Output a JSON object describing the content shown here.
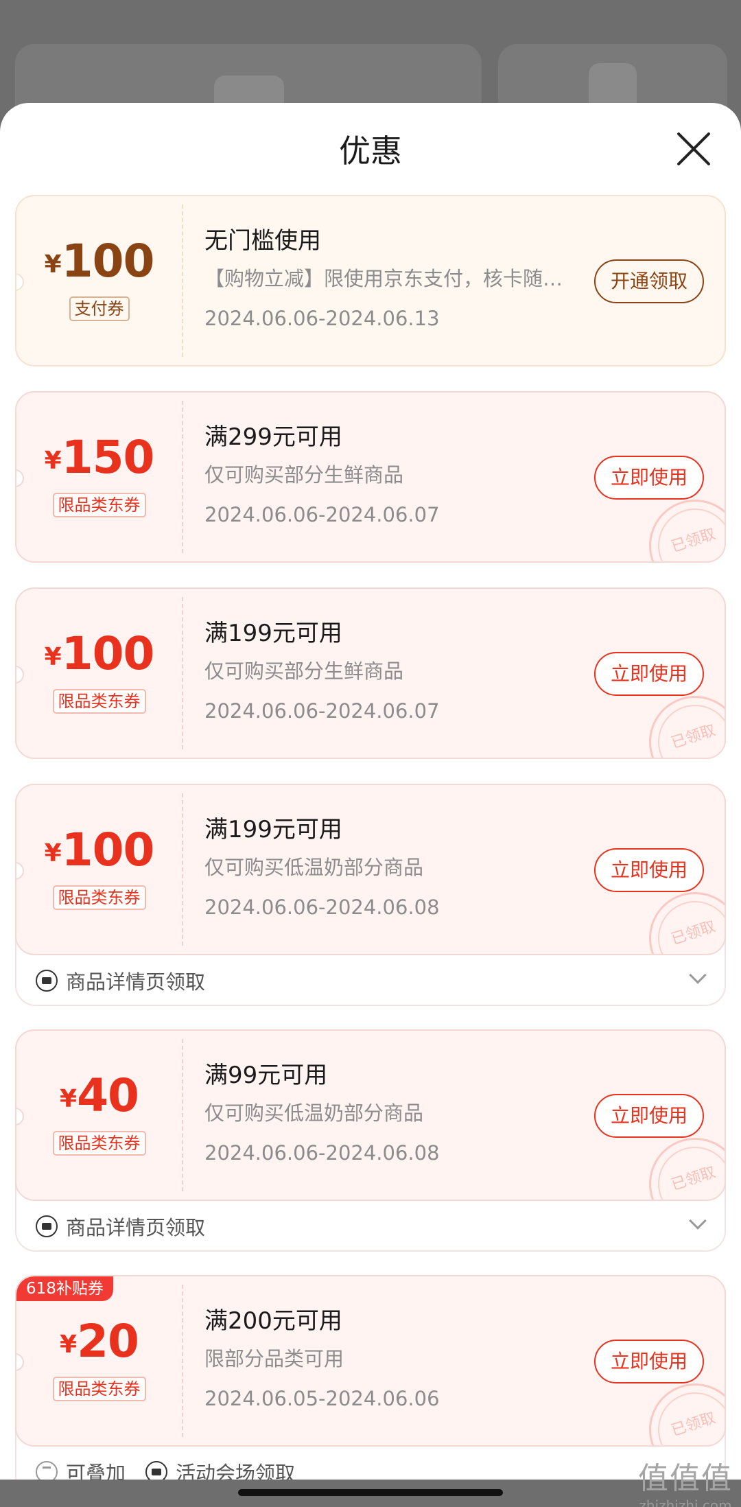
{
  "sheet": {
    "title": "优惠"
  },
  "coupons": [
    {
      "currency": "¥",
      "amount": "100",
      "type_tag": "支付券",
      "condition": "无门槛使用",
      "description": "【购物立减】限使用京东支付，核卡随机立减",
      "date_range": "2024.06.06-2024.06.13",
      "action": "开通领取",
      "style": "gold"
    },
    {
      "currency": "¥",
      "amount": "150",
      "type_tag": "限品类东券",
      "condition": "满299元可用",
      "description": "仅可购买部分生鲜商品",
      "date_range": "2024.06.06-2024.06.07",
      "action": "立即使用",
      "stamp": "已领取"
    },
    {
      "currency": "¥",
      "amount": "100",
      "type_tag": "限品类东券",
      "condition": "满199元可用",
      "description": "仅可购买部分生鲜商品",
      "date_range": "2024.06.06-2024.06.07",
      "action": "立即使用",
      "stamp": "已领取"
    },
    {
      "currency": "¥",
      "amount": "100",
      "type_tag": "限品类东券",
      "condition": "满199元可用",
      "description": "仅可购买低温奶部分商品",
      "date_range": "2024.06.06-2024.06.08",
      "action": "立即使用",
      "stamp": "已领取",
      "footer": "商品详情页领取"
    },
    {
      "currency": "¥",
      "amount": "40",
      "type_tag": "限品类东券",
      "condition": "满99元可用",
      "description": "仅可购买低温奶部分商品",
      "date_range": "2024.06.06-2024.06.08",
      "action": "立即使用",
      "stamp": "已领取",
      "footer": "商品详情页领取"
    },
    {
      "badge": "618补贴券",
      "currency": "¥",
      "amount": "20",
      "type_tag": "限品类东券",
      "condition": "满200元可用",
      "description": "限部分品类可用",
      "date_range": "2024.06.05-2024.06.06",
      "action": "立即使用",
      "stamp": "已领取",
      "footer_stack": "可叠加",
      "footer": "活动会场领取"
    }
  ],
  "watermark": {
    "main": "值值值",
    "sub": "zhizhizhi.com"
  },
  "colors": {
    "accent": "#e8321e",
    "gold": "#8a4313",
    "badge": "#f03a33"
  },
  "icons": {
    "close": "close-icon",
    "ticket": "ticket-icon",
    "stack": "stack-icon",
    "chevron": "chevron-down-icon"
  }
}
